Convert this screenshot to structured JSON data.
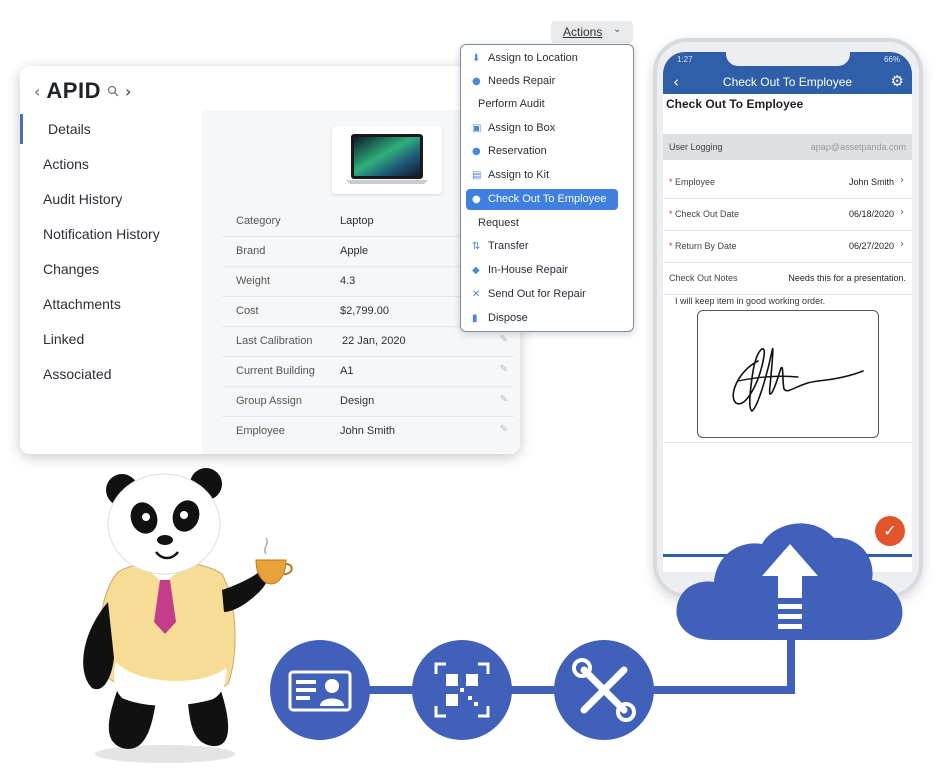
{
  "asset": {
    "title": "APID",
    "sidebar": [
      "Details",
      "Actions",
      "Audit History",
      "Notification History",
      "Changes",
      "Attachments",
      "Linked",
      "Associated"
    ],
    "fields": [
      {
        "label": "Category",
        "value": "Laptop"
      },
      {
        "label": "Brand",
        "value": "Apple"
      },
      {
        "label": "Weight",
        "value": "4.3"
      },
      {
        "label": "Cost",
        "value": "$2,799.00"
      },
      {
        "label": "Last Calibration",
        "value": "22 Jan, 2020"
      },
      {
        "label": "Current Building",
        "value": "A1"
      },
      {
        "label": "Group Assign",
        "value": "Design"
      },
      {
        "label": "Employee",
        "value": "John Smith"
      }
    ]
  },
  "actions": {
    "button_label": "Actions",
    "menu": [
      {
        "label": "Assign to Location",
        "icon": "location-pin-icon"
      },
      {
        "label": "Needs Repair",
        "icon": "question-icon"
      },
      {
        "label": "Perform Audit",
        "icon": ""
      },
      {
        "label": "Assign to Box",
        "icon": "box-icon"
      },
      {
        "label": "Reservation",
        "icon": "person-icon"
      },
      {
        "label": "Assign to Kit",
        "icon": "kit-icon"
      },
      {
        "label": "Check Out To Employee",
        "icon": "person-icon",
        "highlighted": true
      },
      {
        "label": "Request",
        "icon": ""
      },
      {
        "label": "Transfer",
        "icon": "transfer-icon"
      },
      {
        "label": "In-House Repair",
        "icon": "shield-icon"
      },
      {
        "label": "Send Out for Repair",
        "icon": "tools-icon"
      },
      {
        "label": "Dispose",
        "icon": "trash-icon"
      }
    ]
  },
  "phone": {
    "status_time": "1:27",
    "battery": "66%",
    "nav_title": "Check Out To Employee",
    "page_title": "Check Out To Employee",
    "user_logging_label": "User Logging",
    "user_logging_value": "apap@assetpanda.com",
    "rows": [
      {
        "label": "Employee",
        "value": "John Smith",
        "required": true
      },
      {
        "label": "Check Out Date",
        "value": "06/18/2020",
        "required": true
      },
      {
        "label": "Return By Date",
        "value": "06/27/2020",
        "required": true
      },
      {
        "label": "Check Out Notes",
        "value": "Needs this for a presentation.",
        "required": false
      }
    ],
    "agreement": "I will keep item in good working order."
  },
  "colors": {
    "brand_blue": "#4160b9",
    "phone_header": "#2f5fa8",
    "highlight": "#3f7fe0",
    "submit": "#e2552c"
  }
}
